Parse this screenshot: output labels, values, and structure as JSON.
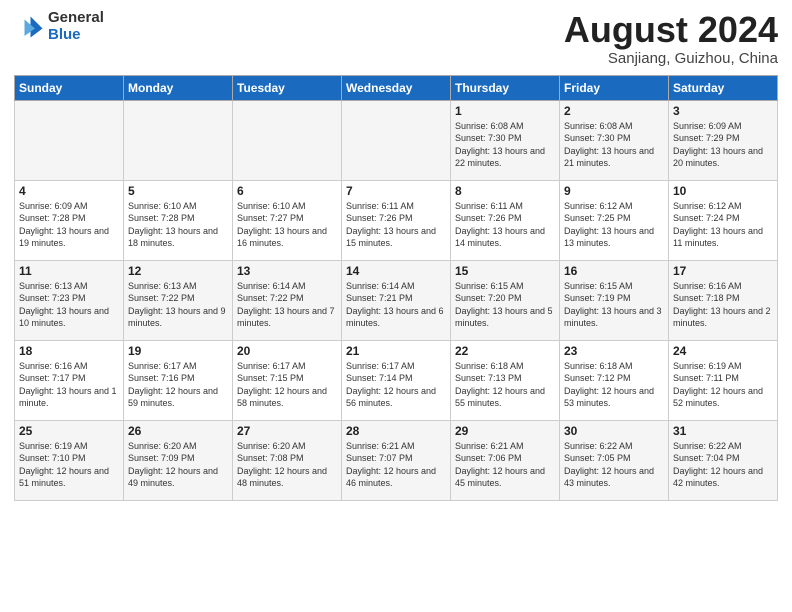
{
  "logo": {
    "general": "General",
    "blue": "Blue"
  },
  "title": "August 2024",
  "location": "Sanjiang, Guizhou, China",
  "weekdays": [
    "Sunday",
    "Monday",
    "Tuesday",
    "Wednesday",
    "Thursday",
    "Friday",
    "Saturday"
  ],
  "weeks": [
    [
      {
        "day": "",
        "info": ""
      },
      {
        "day": "",
        "info": ""
      },
      {
        "day": "",
        "info": ""
      },
      {
        "day": "",
        "info": ""
      },
      {
        "day": "1",
        "info": "Sunrise: 6:08 AM\nSunset: 7:30 PM\nDaylight: 13 hours\nand 22 minutes."
      },
      {
        "day": "2",
        "info": "Sunrise: 6:08 AM\nSunset: 7:30 PM\nDaylight: 13 hours\nand 21 minutes."
      },
      {
        "day": "3",
        "info": "Sunrise: 6:09 AM\nSunset: 7:29 PM\nDaylight: 13 hours\nand 20 minutes."
      }
    ],
    [
      {
        "day": "4",
        "info": "Sunrise: 6:09 AM\nSunset: 7:28 PM\nDaylight: 13 hours\nand 19 minutes."
      },
      {
        "day": "5",
        "info": "Sunrise: 6:10 AM\nSunset: 7:28 PM\nDaylight: 13 hours\nand 18 minutes."
      },
      {
        "day": "6",
        "info": "Sunrise: 6:10 AM\nSunset: 7:27 PM\nDaylight: 13 hours\nand 16 minutes."
      },
      {
        "day": "7",
        "info": "Sunrise: 6:11 AM\nSunset: 7:26 PM\nDaylight: 13 hours\nand 15 minutes."
      },
      {
        "day": "8",
        "info": "Sunrise: 6:11 AM\nSunset: 7:26 PM\nDaylight: 13 hours\nand 14 minutes."
      },
      {
        "day": "9",
        "info": "Sunrise: 6:12 AM\nSunset: 7:25 PM\nDaylight: 13 hours\nand 13 minutes."
      },
      {
        "day": "10",
        "info": "Sunrise: 6:12 AM\nSunset: 7:24 PM\nDaylight: 13 hours\nand 11 minutes."
      }
    ],
    [
      {
        "day": "11",
        "info": "Sunrise: 6:13 AM\nSunset: 7:23 PM\nDaylight: 13 hours\nand 10 minutes."
      },
      {
        "day": "12",
        "info": "Sunrise: 6:13 AM\nSunset: 7:22 PM\nDaylight: 13 hours\nand 9 minutes."
      },
      {
        "day": "13",
        "info": "Sunrise: 6:14 AM\nSunset: 7:22 PM\nDaylight: 13 hours\nand 7 minutes."
      },
      {
        "day": "14",
        "info": "Sunrise: 6:14 AM\nSunset: 7:21 PM\nDaylight: 13 hours\nand 6 minutes."
      },
      {
        "day": "15",
        "info": "Sunrise: 6:15 AM\nSunset: 7:20 PM\nDaylight: 13 hours\nand 5 minutes."
      },
      {
        "day": "16",
        "info": "Sunrise: 6:15 AM\nSunset: 7:19 PM\nDaylight: 13 hours\nand 3 minutes."
      },
      {
        "day": "17",
        "info": "Sunrise: 6:16 AM\nSunset: 7:18 PM\nDaylight: 13 hours\nand 2 minutes."
      }
    ],
    [
      {
        "day": "18",
        "info": "Sunrise: 6:16 AM\nSunset: 7:17 PM\nDaylight: 13 hours\nand 1 minute."
      },
      {
        "day": "19",
        "info": "Sunrise: 6:17 AM\nSunset: 7:16 PM\nDaylight: 12 hours\nand 59 minutes."
      },
      {
        "day": "20",
        "info": "Sunrise: 6:17 AM\nSunset: 7:15 PM\nDaylight: 12 hours\nand 58 minutes."
      },
      {
        "day": "21",
        "info": "Sunrise: 6:17 AM\nSunset: 7:14 PM\nDaylight: 12 hours\nand 56 minutes."
      },
      {
        "day": "22",
        "info": "Sunrise: 6:18 AM\nSunset: 7:13 PM\nDaylight: 12 hours\nand 55 minutes."
      },
      {
        "day": "23",
        "info": "Sunrise: 6:18 AM\nSunset: 7:12 PM\nDaylight: 12 hours\nand 53 minutes."
      },
      {
        "day": "24",
        "info": "Sunrise: 6:19 AM\nSunset: 7:11 PM\nDaylight: 12 hours\nand 52 minutes."
      }
    ],
    [
      {
        "day": "25",
        "info": "Sunrise: 6:19 AM\nSunset: 7:10 PM\nDaylight: 12 hours\nand 51 minutes."
      },
      {
        "day": "26",
        "info": "Sunrise: 6:20 AM\nSunset: 7:09 PM\nDaylight: 12 hours\nand 49 minutes."
      },
      {
        "day": "27",
        "info": "Sunrise: 6:20 AM\nSunset: 7:08 PM\nDaylight: 12 hours\nand 48 minutes."
      },
      {
        "day": "28",
        "info": "Sunrise: 6:21 AM\nSunset: 7:07 PM\nDaylight: 12 hours\nand 46 minutes."
      },
      {
        "day": "29",
        "info": "Sunrise: 6:21 AM\nSunset: 7:06 PM\nDaylight: 12 hours\nand 45 minutes."
      },
      {
        "day": "30",
        "info": "Sunrise: 6:22 AM\nSunset: 7:05 PM\nDaylight: 12 hours\nand 43 minutes."
      },
      {
        "day": "31",
        "info": "Sunrise: 6:22 AM\nSunset: 7:04 PM\nDaylight: 12 hours\nand 42 minutes."
      }
    ]
  ]
}
